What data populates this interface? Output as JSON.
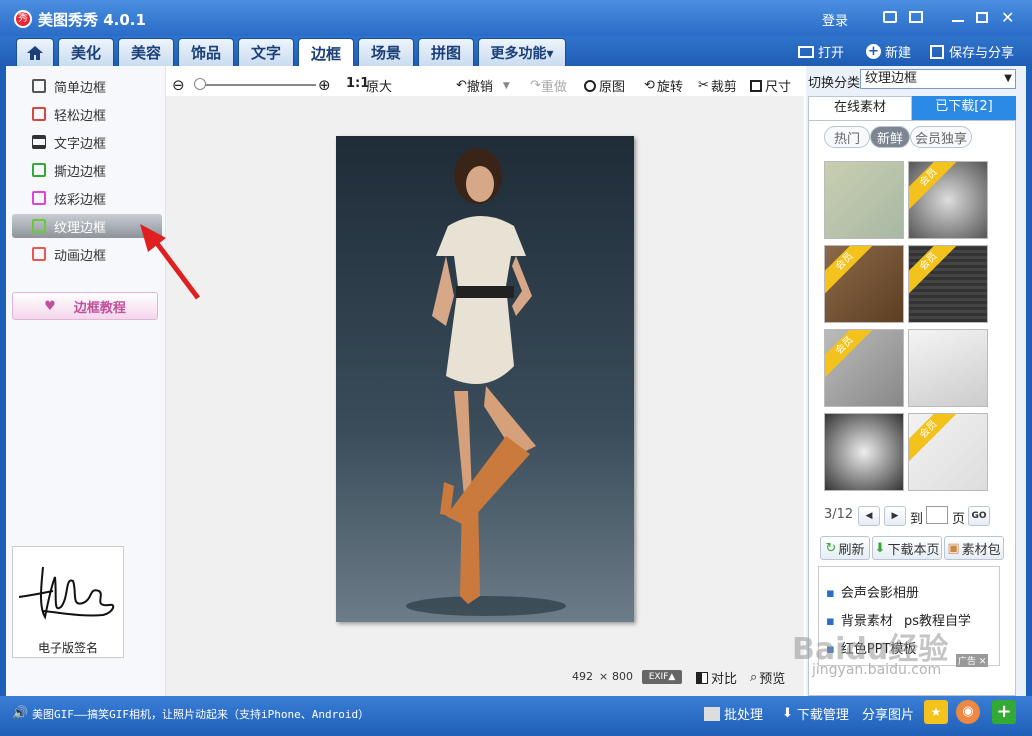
{
  "app": {
    "title": "美图秀秀 4.0.1",
    "logo_glyph": "秀"
  },
  "titlebar": {
    "login": "登录"
  },
  "tabs": [
    {
      "label": "美化"
    },
    {
      "label": "美容"
    },
    {
      "label": "饰品"
    },
    {
      "label": "文字"
    },
    {
      "label": "边框"
    },
    {
      "label": "场景"
    },
    {
      "label": "拼图"
    },
    {
      "label": "更多功能▾"
    }
  ],
  "topactions": {
    "open": "打开",
    "new": "新建",
    "save": "保存与分享"
  },
  "leftmenu": [
    "简单边框",
    "轻松边框",
    "文字边框",
    "撕边边框",
    "炫彩边框",
    "纹理边框",
    "动画边框"
  ],
  "tutorial": "边框教程",
  "signature": {
    "caption": "电子版签名"
  },
  "toolbar": {
    "zoom_ratio": "1:1",
    "original_size": "原大",
    "undo": "撤销",
    "redo": "重做",
    "original": "原图",
    "rotate": "旋转",
    "crop": "裁剪",
    "resize": "尺寸"
  },
  "canvas": {
    "width": "492",
    "times": "×",
    "height": "800",
    "exif": "EXIF▲",
    "compare": "对比",
    "preview": "预览"
  },
  "right": {
    "category_label": "切换分类",
    "category_value": "纹理边框",
    "tab_online": "在线素材",
    "tab_downloaded": "已下载[2]",
    "filters": [
      "热门",
      "新鲜",
      "会员独享"
    ],
    "member_tag": "会员",
    "page": {
      "current": "3/12",
      "goto": "到",
      "page_unit": "页",
      "go": "GO"
    },
    "actions": {
      "refresh": "刷新",
      "download_page": "下载本页",
      "pack": "素材包"
    },
    "ads": [
      "会声会影相册",
      "背景素材",
      "ps教程自学",
      "红色PPT模板"
    ],
    "ad_tag": "广告"
  },
  "statusbar": {
    "message": "美图GIF——搞笑GIF相机，让照片动起来（支持iPhone、Android）",
    "batch": "批处理",
    "download_manager": "下载管理",
    "share_image": "分享图片"
  },
  "watermark": {
    "brand": "Baidu经验",
    "url": "jingyan.baidu.com"
  },
  "colors": {
    "accent": "#2a6cc8",
    "member_ribbon": "#f4c21d",
    "arrow": "#e02020"
  }
}
